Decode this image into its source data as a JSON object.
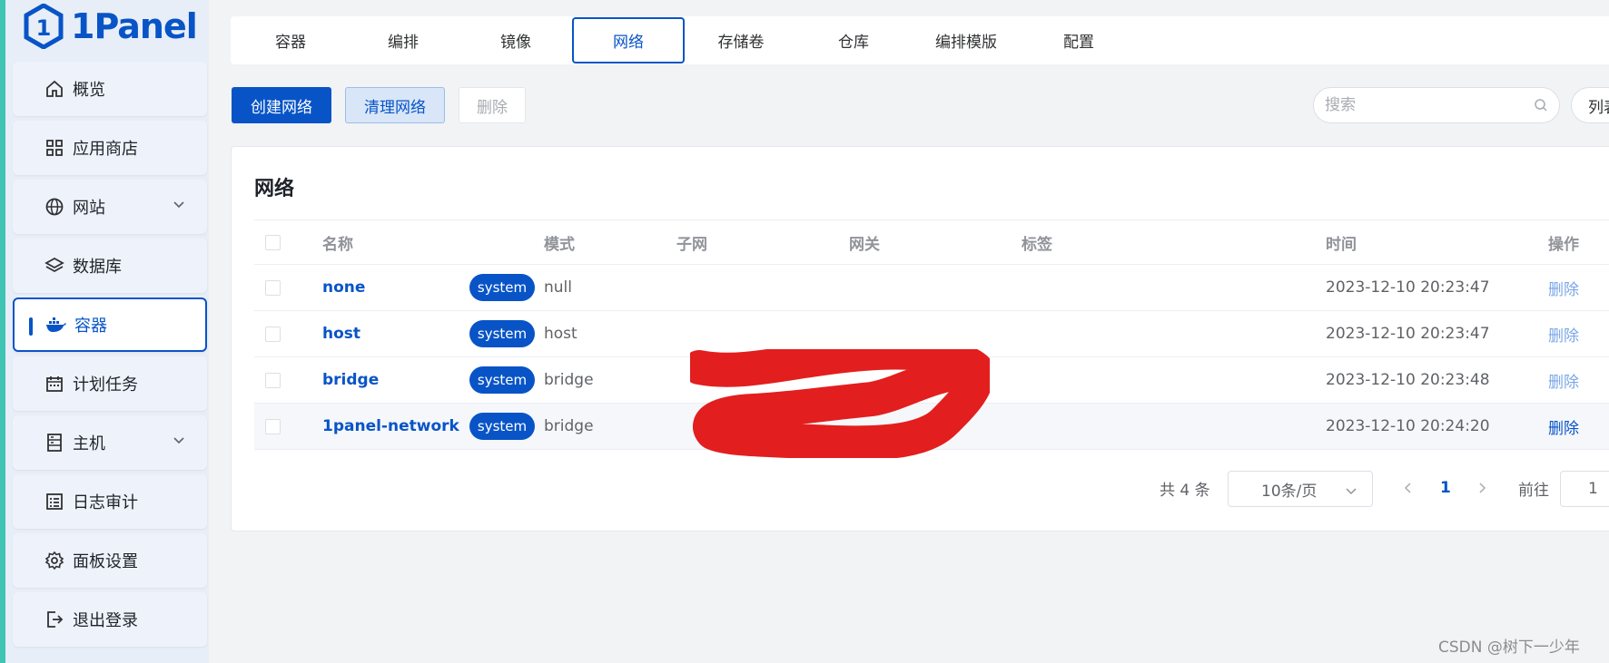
{
  "app": {
    "logo_text": "1Panel"
  },
  "sidebar": {
    "items": [
      {
        "label": "概览",
        "icon": "home-icon"
      },
      {
        "label": "应用商店",
        "icon": "grid-icon"
      },
      {
        "label": "网站",
        "icon": "globe-icon",
        "expandable": true
      },
      {
        "label": "数据库",
        "icon": "layers-icon"
      },
      {
        "label": "容器",
        "icon": "docker-icon",
        "active": true
      },
      {
        "label": "计划任务",
        "icon": "calendar-icon"
      },
      {
        "label": "主机",
        "icon": "server-icon",
        "expandable": true
      },
      {
        "label": "日志审计",
        "icon": "log-icon"
      },
      {
        "label": "面板设置",
        "icon": "gear-icon"
      },
      {
        "label": "退出登录",
        "icon": "logout-icon"
      }
    ]
  },
  "tabs": [
    {
      "label": "容器"
    },
    {
      "label": "编排"
    },
    {
      "label": "镜像"
    },
    {
      "label": "网络",
      "active": true
    },
    {
      "label": "存储卷"
    },
    {
      "label": "仓库"
    },
    {
      "label": "编排模版"
    },
    {
      "label": "配置"
    }
  ],
  "toolbar": {
    "create_label": "创建网络",
    "prune_label": "清理网络",
    "delete_label": "删除",
    "search_placeholder": "搜索",
    "list_label": "列表"
  },
  "card": {
    "title": "网络",
    "columns": {
      "name": "名称",
      "mode": "模式",
      "subnet": "子网",
      "gateway": "网关",
      "labels": "标签",
      "time": "时间",
      "ops": "操作"
    },
    "rows": [
      {
        "name": "none",
        "tag": "system",
        "mode": "null",
        "time": "2023-12-10 20:23:47",
        "op": "删除"
      },
      {
        "name": "host",
        "tag": "system",
        "mode": "host",
        "time": "2023-12-10 20:23:47",
        "op": "删除"
      },
      {
        "name": "bridge",
        "tag": "system",
        "mode": "bridge",
        "time": "2023-12-10 20:23:48",
        "op": "删除"
      },
      {
        "name": "1panel-network",
        "tag": "system",
        "mode": "bridge",
        "time": "2023-12-10 20:24:20",
        "op": "删除"
      }
    ]
  },
  "pagination": {
    "total_label": "共 4 条",
    "page_size": "10条/页",
    "current_page": "1",
    "goto_label": "前往",
    "goto_value": "1"
  },
  "colors": {
    "primary": "#0854c7",
    "redaction": "#e31e1e"
  },
  "watermark": "CSDN @树下一少年"
}
